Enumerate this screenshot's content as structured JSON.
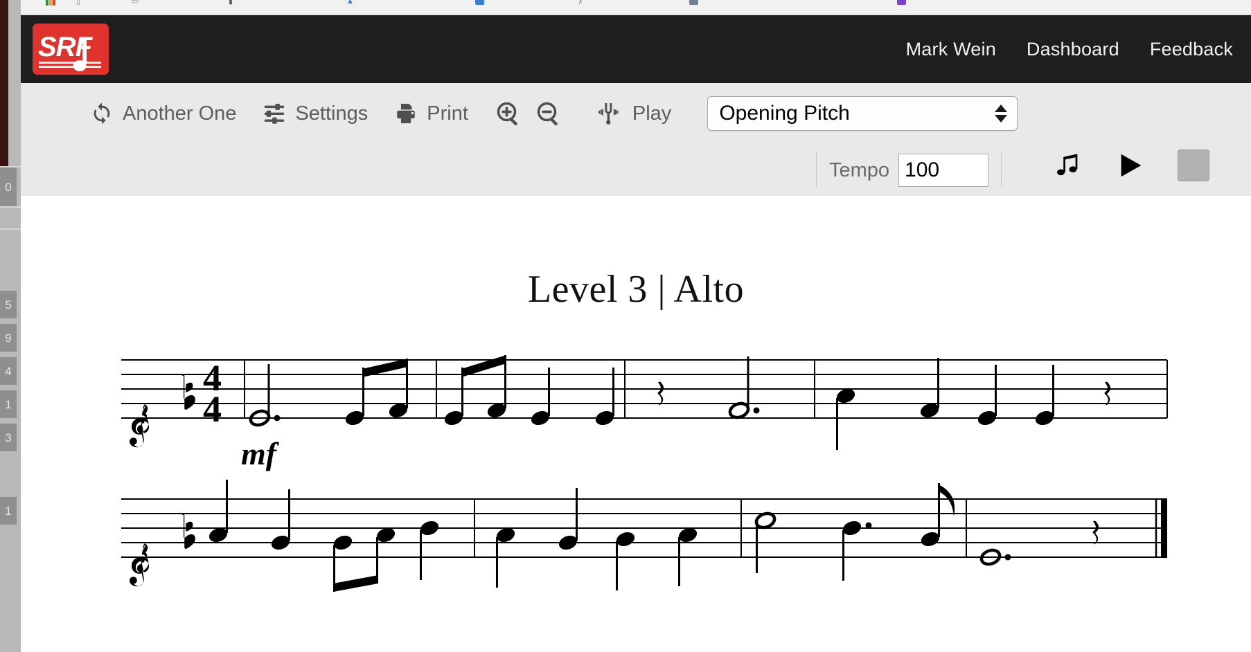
{
  "browser_chrome": {
    "bookmark_icons": [
      "apps-grid-icon",
      "document-icon",
      "mail-icon",
      "bookmark-icon",
      "drive-icon",
      "facebook-icon",
      "music-icon",
      "calendar-icon",
      "app-icon"
    ]
  },
  "background_window": {
    "tab_labels": [
      "0",
      "5",
      "9",
      "4",
      "1",
      "3",
      "1"
    ]
  },
  "header": {
    "logo_text": "SRF",
    "logo_color": "#e0332e",
    "background_color": "#1e1e1e",
    "nav": [
      {
        "label": "Mark Wein",
        "name": "nav-user"
      },
      {
        "label": "Dashboard",
        "name": "nav-dashboard"
      },
      {
        "label": "Feedback",
        "name": "nav-feedback"
      }
    ]
  },
  "toolbar": {
    "background_color": "#e9e9e9",
    "another_one_label": "Another One",
    "another_one_icon": "refresh-icon",
    "settings_label": "Settings",
    "settings_icon": "sliders-icon",
    "print_label": "Print",
    "print_icon": "printer-icon",
    "zoom_in_icon": "zoom-in-icon",
    "zoom_out_icon": "zoom-out-icon",
    "play_label": "Play",
    "play_icon": "tuning-fork-icon",
    "pitch_select_value": "Opening Pitch",
    "pitch_select_options": [
      "Opening Pitch"
    ],
    "tempo_label": "Tempo",
    "tempo_value": "100",
    "metronome_icon": "beamed-notes-icon",
    "playback_play_icon": "play-triangle-icon",
    "playback_stop_icon": "stop-square-icon",
    "stop_button_color": "#b2b2b2"
  },
  "score": {
    "title": "Level 3 | Alto",
    "dynamic": "mf",
    "clef": "treble",
    "key_signature": "1 flat",
    "time_signature": "4/4",
    "final_barline": "thin-thick",
    "systems": [
      {
        "name": "system-1",
        "measures": [
          {
            "notes": [
              "dotted-half",
              "eighth-beamed",
              "eighth-beamed"
            ]
          },
          {
            "notes": [
              "eighth-beamed",
              "eighth-beamed",
              "quarter",
              "quarter"
            ]
          },
          {
            "notes": [
              "quarter-rest",
              "dotted-half",
              "quarter"
            ]
          },
          {
            "notes": [
              "quarter",
              "quarter",
              "quarter",
              "quarter-rest"
            ]
          }
        ]
      },
      {
        "name": "system-2",
        "measures": [
          {
            "notes": [
              "quarter",
              "quarter",
              "eighth-beamed",
              "eighth-beamed",
              "quarter"
            ]
          },
          {
            "notes": [
              "quarter",
              "quarter",
              "quarter",
              "quarter"
            ]
          },
          {
            "notes": [
              "half",
              "dotted-quarter",
              "eighth"
            ]
          },
          {
            "notes": [
              "dotted-half",
              "quarter-rest"
            ]
          }
        ]
      }
    ]
  }
}
